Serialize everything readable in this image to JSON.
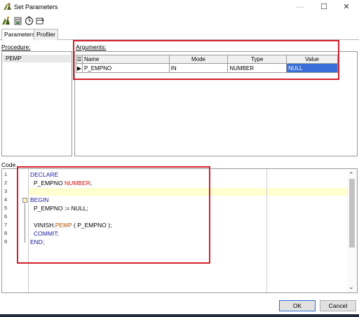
{
  "window": {
    "title": "Set Parameters",
    "minimize_glyph": "—",
    "maximize_glyph": "☐",
    "close_glyph": "✕"
  },
  "toolbar": {
    "icons": [
      "set-parameters-icon",
      "database-icon",
      "timer-icon",
      "clear-icon"
    ]
  },
  "tabs": [
    {
      "label": "Parameters",
      "active": true
    },
    {
      "label": "Profiler",
      "active": false
    }
  ],
  "procedure": {
    "label": "Procedure:",
    "items": [
      "PEMP"
    ]
  },
  "arguments": {
    "label": "Arguments:",
    "columns": [
      "Name",
      "Mode",
      "Type",
      "Value"
    ],
    "rows": [
      {
        "name": "P_EMPNO",
        "mode": "IN",
        "type": "NUMBER",
        "value": "NULL"
      }
    ]
  },
  "code": {
    "label": "Code",
    "line_numbers": [
      "1",
      "2",
      "3",
      "4",
      "5",
      "6",
      "7",
      "8",
      "9"
    ],
    "lines": {
      "l1": "DECLARE",
      "l2_name": "P_EMPNO ",
      "l2_type": "NUMBER",
      "l2_end": ";",
      "l4": "BEGIN",
      "l5": "P_EMPNO := NULL;",
      "l7_pre": "VINISH.",
      "l7_obj": "PEMP",
      "l7_post": " ( P_EMPNO );",
      "l8": "COMMIT;",
      "l9": "END;"
    }
  },
  "buttons": {
    "ok": "OK",
    "cancel": "Cancel"
  },
  "colors": {
    "highlight_box": "#d41f2e",
    "selection": "#3a6fd8",
    "keyword": "#1a1a99",
    "type": "#cc1111"
  }
}
